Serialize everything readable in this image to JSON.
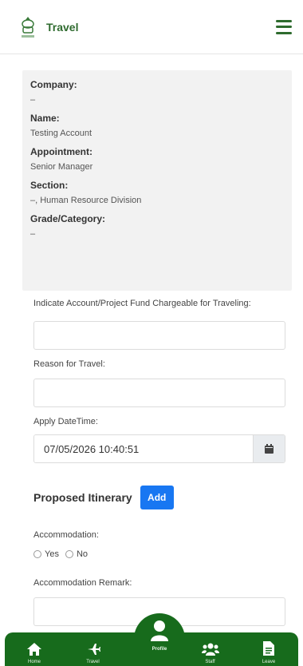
{
  "header": {
    "title": "Travel"
  },
  "info": {
    "company_label": "Company:",
    "company_value": "–",
    "name_label": "Name:",
    "name_value": "Testing Account",
    "appointment_label": "Appointment:",
    "appointment_value": "Senior Manager",
    "section_label": "Section:",
    "section_value": "–, Human Resource Division",
    "grade_label": "Grade/Category:",
    "grade_value": "–"
  },
  "form": {
    "fund_label": "Indicate Account/Project Fund Chargeable for Traveling:",
    "fund_value": "",
    "reason_label": "Reason for Travel:",
    "reason_value": "",
    "date_label": "Apply DateTime:",
    "date_value": "07/05/2026 10:40:51",
    "itinerary_title": "Proposed Itinerary",
    "add_label": "Add",
    "accommodation_label": "Accommodation:",
    "yes_label": "Yes",
    "no_label": "No",
    "remark_label": "Accommodation Remark:"
  },
  "nav": {
    "items": [
      {
        "label": "Home",
        "icon": "home-icon"
      },
      {
        "label": "Travel",
        "icon": "plane-icon"
      },
      {
        "label": "Profile",
        "icon": "user-icon"
      },
      {
        "label": "Staff",
        "icon": "users-icon"
      },
      {
        "label": "Leave",
        "icon": "document-icon"
      }
    ],
    "active": "Profile"
  },
  "colors": {
    "brand_green": "#176b1c",
    "button_blue": "#1877f2",
    "panel_bg": "#f2f2f2"
  }
}
